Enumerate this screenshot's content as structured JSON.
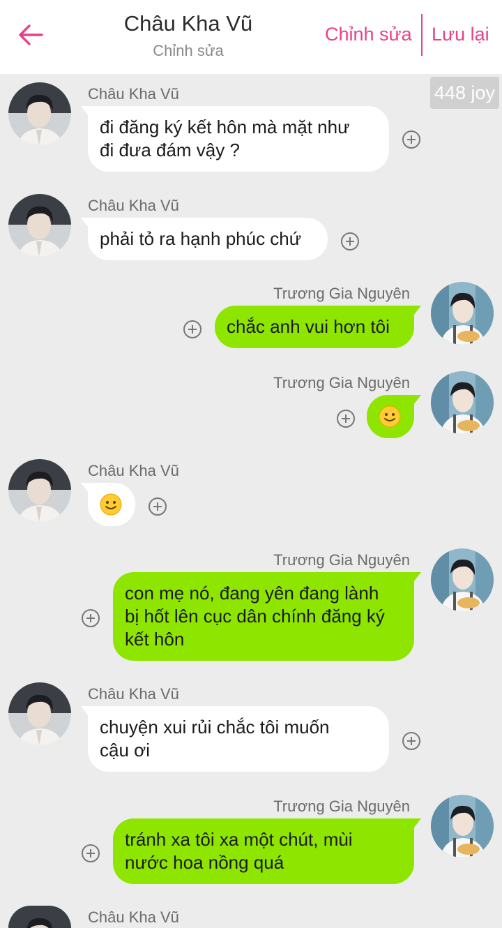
{
  "header": {
    "title": "Châu Kha Vũ",
    "subtitle": "Chỉnh sửa",
    "edit_label": "Chỉnh sửa",
    "save_label": "Lưu lại",
    "back_icon": "arrow-left-icon",
    "accent_color": "#e8418a"
  },
  "badge": {
    "text": "448 joy"
  },
  "colors": {
    "sent_bubble": "#8ee500",
    "received_bubble": "#ffffff",
    "background": "#ececec"
  },
  "messages": [
    {
      "side": "left",
      "sender": "Châu Kha Vũ",
      "lines": [
        "đi đăng ký kết hôn mà mặt như",
        "đi đưa đám vậy ?"
      ]
    },
    {
      "side": "left",
      "sender": "Châu Kha Vũ",
      "lines": [
        "phải tỏ ra hạnh phúc chứ"
      ]
    },
    {
      "side": "right",
      "sender": "Trương Gia Nguyên",
      "lines": [
        "chắc anh vui hơn tôi"
      ]
    },
    {
      "side": "right",
      "sender": "Trương Gia Nguyên",
      "emoji": "slightly-smiling-face-icon"
    },
    {
      "side": "left",
      "sender": "Châu Kha Vũ",
      "emoji": "slightly-smiling-face-icon"
    },
    {
      "side": "right",
      "sender": "Trương Gia Nguyên",
      "lines": [
        "con mẹ nó, đang yên đang lành",
        "bị hốt lên cục dân chính đăng ký",
        "kết hôn"
      ]
    },
    {
      "side": "left",
      "sender": "Châu Kha Vũ",
      "lines": [
        "chuyện xui rủi chắc tôi muốn",
        "cậu ơi"
      ]
    },
    {
      "side": "right",
      "sender": "Trương Gia Nguyên",
      "lines": [
        "tránh xa tôi xa một chút, mùi",
        "nước hoa nồng quá"
      ]
    },
    {
      "side": "left",
      "sender": "Châu Kha Vũ",
      "lines": []
    }
  ]
}
